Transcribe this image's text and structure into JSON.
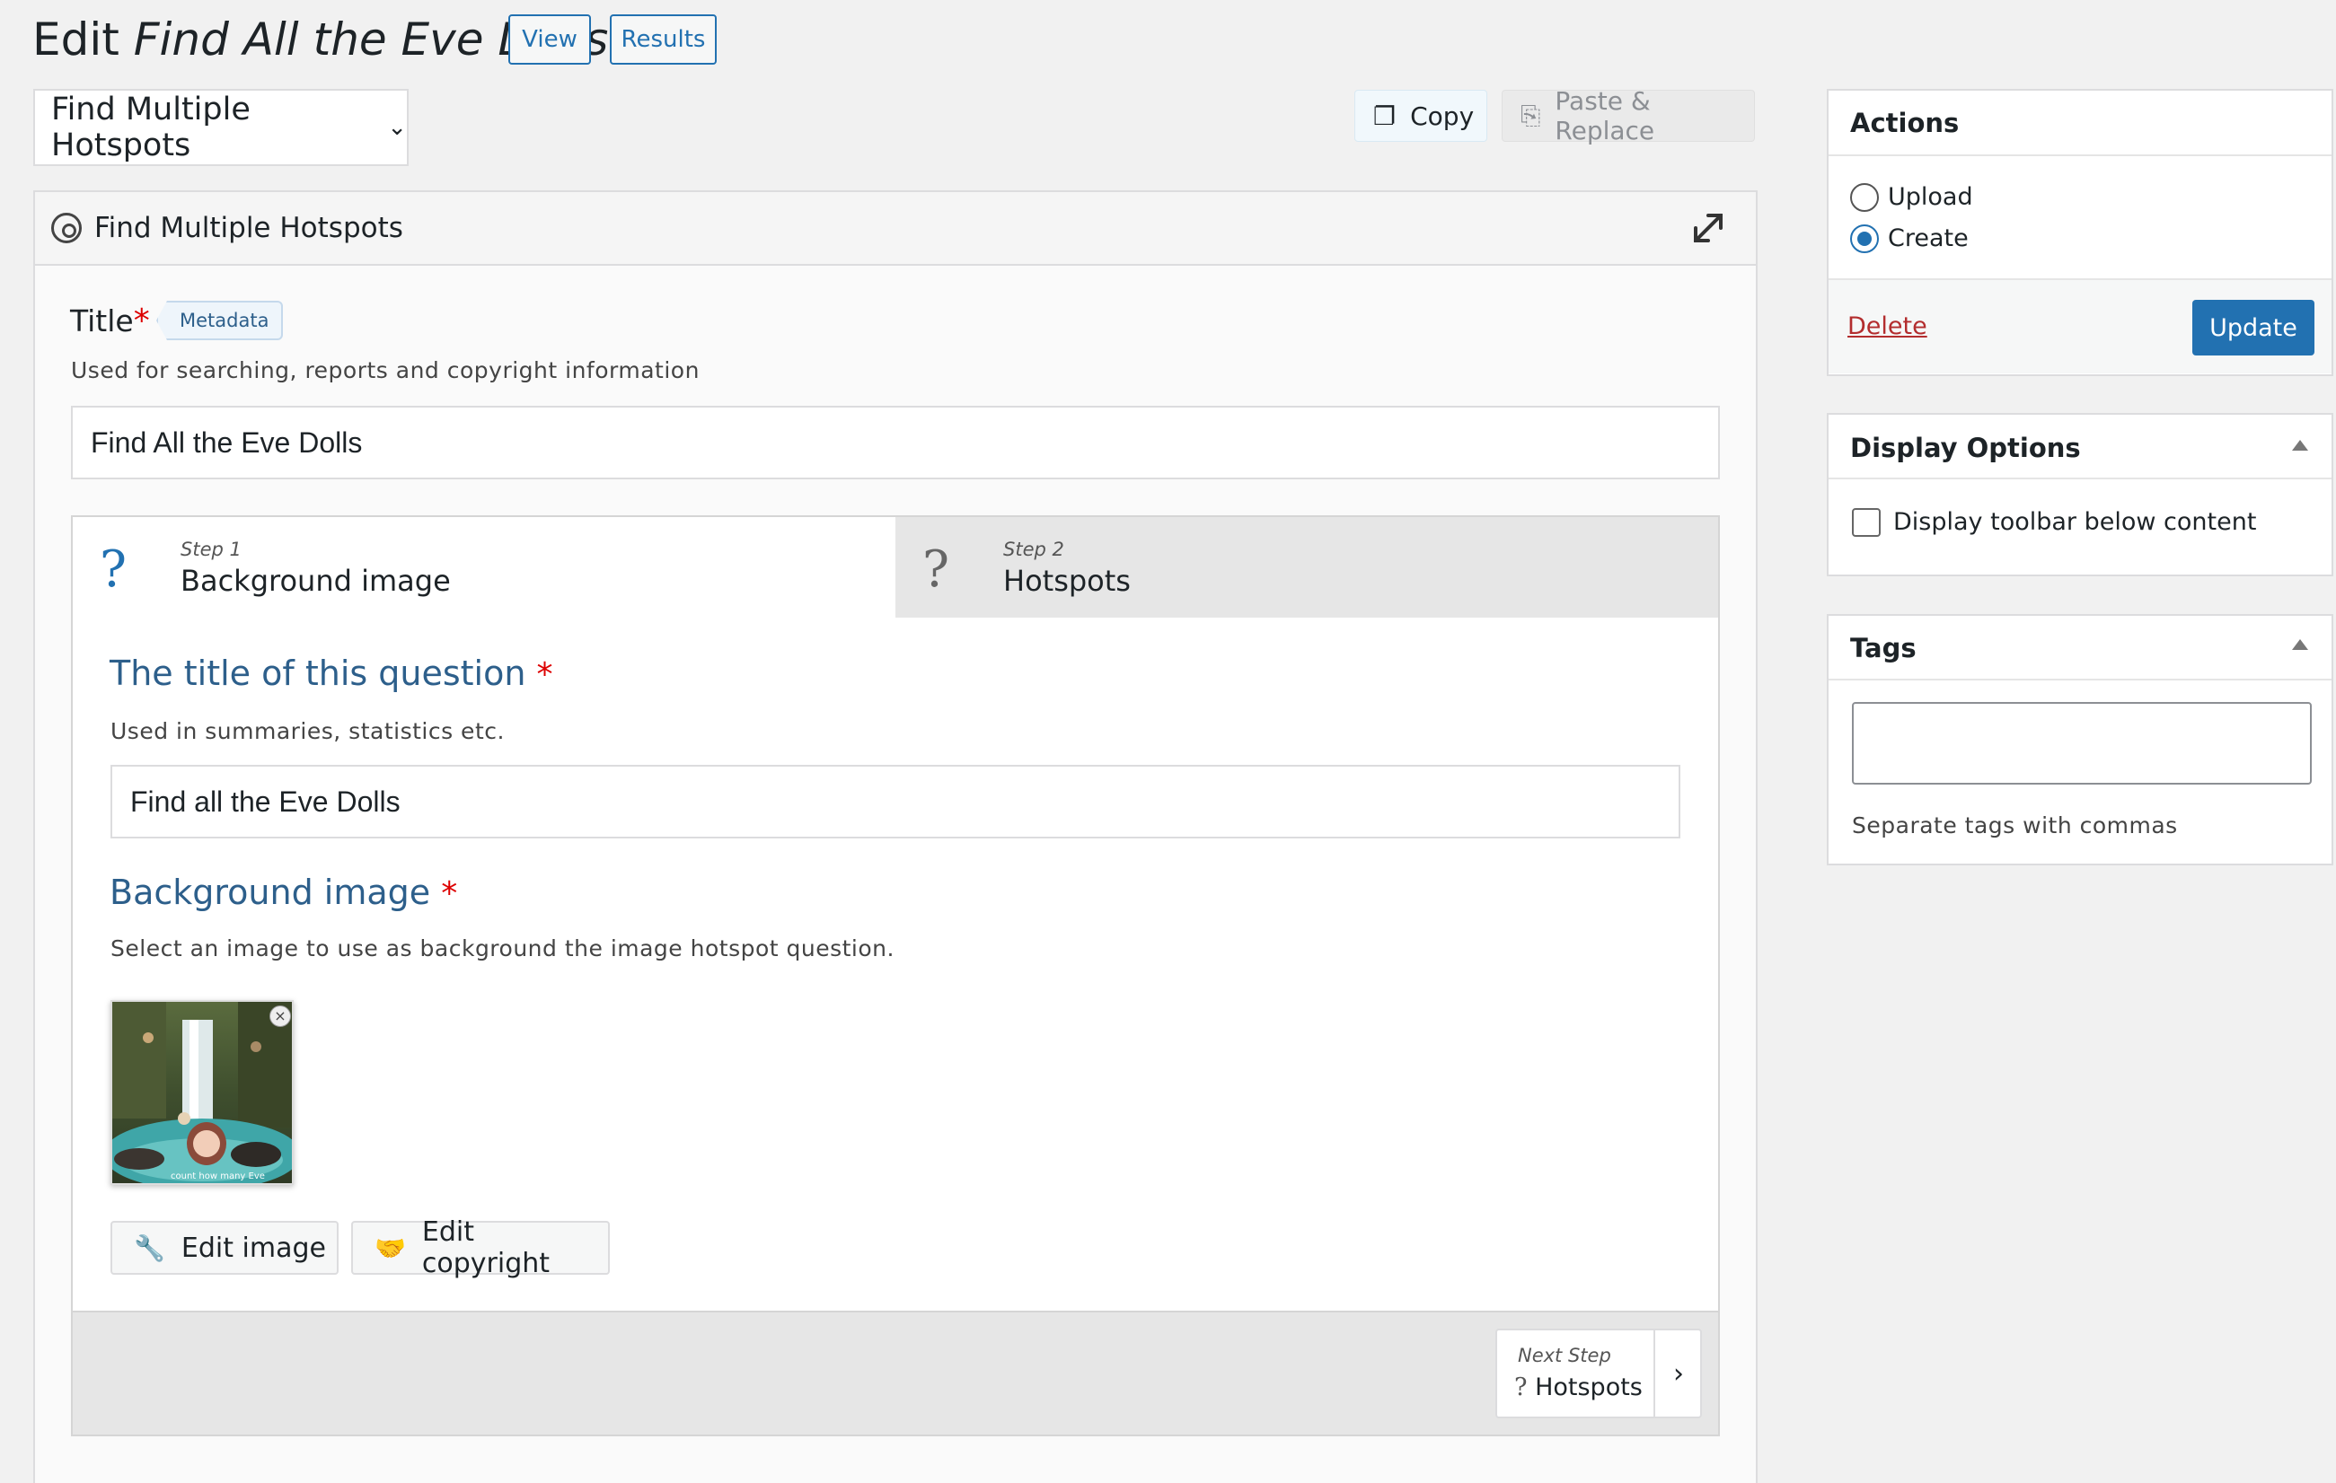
{
  "header": {
    "title_prefix": "Edit ",
    "title_name": "Find All the Eve Dolls",
    "view_label": "View",
    "results_label": "Results"
  },
  "library": {
    "selected": "Find Multiple Hotspots",
    "copy_label": "Copy",
    "paste_label": "Paste & Replace"
  },
  "editor": {
    "content_type_label": "Find Multiple Hotspots",
    "title_field": {
      "label": "Title",
      "badge": "Metadata",
      "description": "Used for searching, reports and copyright information",
      "value": "Find All the Eve Dolls"
    },
    "steps": [
      {
        "step": "Step 1",
        "name": "Background image",
        "icon": "?"
      },
      {
        "step": "Step 2",
        "name": "Hotspots",
        "icon": "?"
      }
    ],
    "question_title": {
      "label": "The title of this question",
      "description": "Used in summaries, statistics etc.",
      "value": "Find all the Eve Dolls"
    },
    "background_image": {
      "label": "Background image",
      "description": "Select an image to use as background the image hotspot question.",
      "thumb_caption": "count how many Eve",
      "edit_image_label": "Edit image",
      "edit_copyright_label": "Edit copyright"
    },
    "next_step": {
      "small": "Next Step",
      "icon": "?",
      "name": "Hotspots"
    }
  },
  "sidebar": {
    "actions": {
      "title": "Actions",
      "options": [
        "Upload",
        "Create"
      ],
      "selected": "Create",
      "delete_label": "Delete",
      "update_label": "Update"
    },
    "display_options": {
      "title": "Display Options",
      "checkbox_label": "Display toolbar below content"
    },
    "tags": {
      "title": "Tags",
      "hint": "Separate tags with commas"
    }
  },
  "colors": {
    "accent": "#2271b1",
    "required": "#dd0000",
    "delete": "#b32d2e",
    "label_blue": "#2d5f8b"
  }
}
